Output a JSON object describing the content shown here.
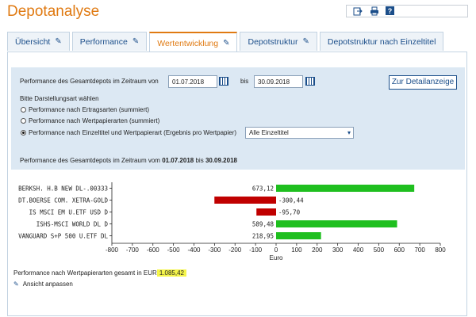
{
  "title": "Depotanalyse",
  "toolbar_icons": [
    "export-icon",
    "print-icon",
    "help-icon"
  ],
  "tabs": [
    {
      "label": "Übersicht",
      "active": false
    },
    {
      "label": "Performance",
      "active": false
    },
    {
      "label": "Wertentwicklung",
      "active": true
    },
    {
      "label": "Depotstruktur",
      "active": false
    },
    {
      "label": "Depotstruktur nach Einzeltitel",
      "active": false
    }
  ],
  "filter": {
    "period_label": "Performance des Gesamtdepots im Zeitraum von",
    "from_date": "01.07.2018",
    "to_label": "bis",
    "to_date": "30.09.2018",
    "detail_button": "Zur Detailanzeige",
    "display_type_label": "Bitte Darstellungsart wählen",
    "options": [
      "Performance nach Ertragsarten (summiert)",
      "Performance nach Wertpapierarten (summiert)",
      "Performance nach Einzeltitel und Wertpapierart (Ergebnis pro Wertpapier)"
    ],
    "selected_option": 2,
    "select_value": "Alle Einzeltitel",
    "summary_prefix": "Performance des Gesamtdepots im Zeitraum vom",
    "summary_from": "01.07.2018",
    "summary_mid": "bis",
    "summary_to": "30.09.2018"
  },
  "chart_data": {
    "type": "bar",
    "orientation": "horizontal",
    "categories": [
      "BERKSH. H.B NEW DL-.00333",
      "DT.BOERSE COM. XETRA-GOLD",
      "IS MSCI EM U.ETF USD D",
      "ISHS-MSCI WORLD DL D",
      "VANGUARD S+P 500 U.ETF DL"
    ],
    "values": [
      673.12,
      -300.44,
      -95.7,
      589.48,
      218.95
    ],
    "value_labels": [
      "673,12",
      "-300,44",
      "-95,70",
      "589,48",
      "218,95"
    ],
    "xlabel": "Euro",
    "xlim": [
      -800,
      800
    ],
    "xticks": [
      -800,
      -700,
      -600,
      -500,
      -400,
      -300,
      -200,
      -100,
      0,
      100,
      200,
      300,
      400,
      500,
      600,
      700,
      800
    ],
    "colors": {
      "positive": "#1fbf1f",
      "negative": "#c00000"
    }
  },
  "footer": {
    "total_label": "Performance nach Wertpapierarten gesamt in EUR",
    "total_value": "1.085,42",
    "adjust_link": "Ansicht anpassen"
  }
}
